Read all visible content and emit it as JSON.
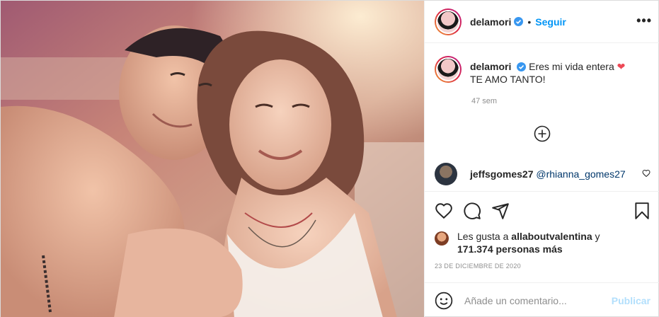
{
  "post": {
    "header": {
      "username": "delamori",
      "verified_icon": "verified-badge-icon",
      "separator": "•",
      "follow_label": "Seguir",
      "more_label": "•••"
    },
    "caption": {
      "username": "delamori",
      "text_line1": "Eres mi vida entera",
      "heart": "❤",
      "text_line2": "TE AMO TANTO!",
      "time": "47 sem"
    },
    "comments": [
      {
        "username": "jeffsgomes27",
        "mention": "@rhianna_gomes27"
      }
    ],
    "likes": {
      "prefix": "Les gusta a",
      "first_user": "allaboutvalentina",
      "connector": "y",
      "count": "171.374",
      "suffix": "personas más"
    },
    "date": "23 DE DICIEMBRE DE 2020",
    "add_comment": {
      "placeholder": "Añade un comentario...",
      "publish_label": "Publicar"
    },
    "colors": {
      "accent": "#0095f6",
      "heart": "#ed4956",
      "muted": "#8e8e8e",
      "publish_disabled": "#b2dffc"
    }
  }
}
